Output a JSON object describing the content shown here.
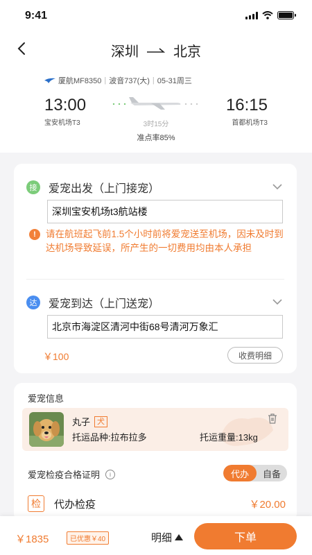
{
  "status_bar": {
    "time": "9:41"
  },
  "nav": {
    "from": "深圳",
    "to": "北京"
  },
  "flight": {
    "airline": "厦航MF8350",
    "aircraft": "波音737(大)",
    "date": "05-31周三",
    "depart_time": "13:00",
    "depart_airport": "宝安机场T3",
    "arrive_time": "16:15",
    "arrive_airport": "首都机场T3",
    "duration": "3时15分",
    "on_time_rate": "准点率85%"
  },
  "pickup": {
    "badge": "接",
    "title": "爱宠出发（上门接宠）",
    "address": "深圳宝安机场t3航站楼",
    "warning_icon": "!",
    "warning": "请在航班起飞前1.5个小时前将爱宠送至机场，因未及时到达机场导致延误，所产生的一切费用均由本人承担"
  },
  "delivery": {
    "badge": "达",
    "title": "爱宠到达（上门送宠）",
    "address": "北京市海淀区清河中街68号清河万象汇",
    "price": "￥100",
    "fee_detail_label": "收费明细"
  },
  "pet_info": {
    "section_title": "爱宠信息",
    "name": "丸子",
    "tag": "犬",
    "breed": "托运品种:拉布拉多",
    "weight": "托运重量:13kg"
  },
  "quarantine": {
    "label": "爱宠检疫合格证明",
    "info_icon": "i",
    "option_agent": "代办",
    "option_self": "自备",
    "selected": "代办",
    "tag": "检",
    "item": "代办检疫",
    "price": "￥20.00"
  },
  "bottom": {
    "total": "￥1835",
    "discount": "已优惠￥40",
    "detail": "明细",
    "submit": "下单"
  },
  "colors": {
    "accent": "#f07b30",
    "pickup_badge": "#7ccc7a",
    "delivery_badge": "#4a8ef0"
  }
}
